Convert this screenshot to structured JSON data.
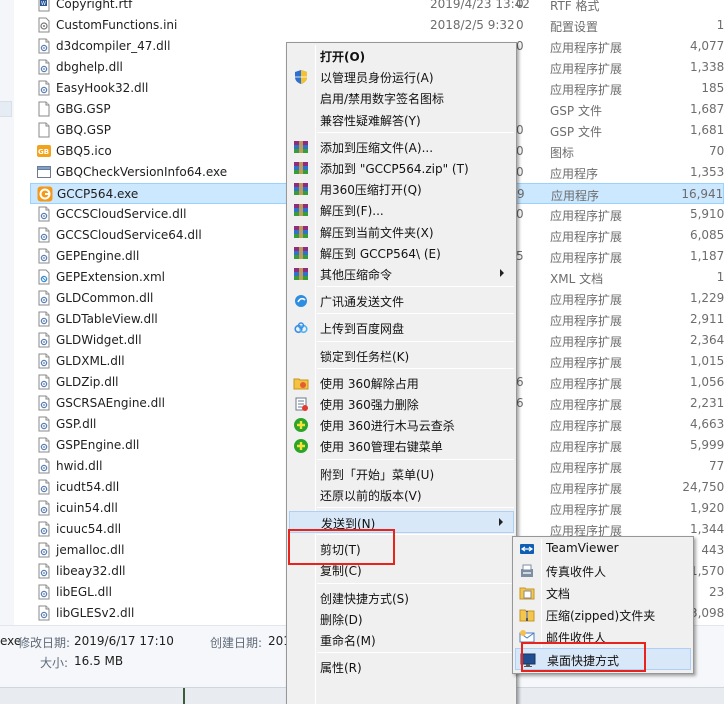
{
  "files": [
    {
      "name": "Copyright.rtf",
      "date": "2019/4/23 13:42",
      "type": "RTF 格式",
      "size": "",
      "icon": "rtf-file-icon"
    },
    {
      "name": "CustomFunctions.ini",
      "date": "2018/2/5 9:32",
      "type": "配置设置",
      "size": "1 K",
      "icon": "ini-file-icon"
    },
    {
      "name": "d3dcompiler_47.dll",
      "date": "",
      "type": "应用程序扩展",
      "size": "4,077 K",
      "icon": "dll-file-icon"
    },
    {
      "name": "dbghelp.dll",
      "date": "",
      "type": "应用程序扩展",
      "size": "1,338 K",
      "icon": "dll-file-icon"
    },
    {
      "name": "EasyHook32.dll",
      "date": "",
      "type": "应用程序扩展",
      "size": "185 K",
      "icon": "dll-file-icon"
    },
    {
      "name": "GBG.GSP",
      "date": "",
      "type": "GSP 文件",
      "size": "1,687 K",
      "icon": "blank-file-icon"
    },
    {
      "name": "GBQ.GSP",
      "date": "",
      "type": "GSP 文件",
      "size": "1,681 K",
      "icon": "blank-file-icon"
    },
    {
      "name": "GBQ5.ico",
      "date": "",
      "type": "图标",
      "size": "70 K",
      "icon": "ico-file-icon"
    },
    {
      "name": "GBQCheckVersionInfo64.exe",
      "date": "",
      "type": "应用程序",
      "size": "1,353 K",
      "icon": "exe-file-icon"
    },
    {
      "name": "GCCP564.exe",
      "date": "",
      "type": "应用程序",
      "size": "16,941 K",
      "icon": "gccp-app-icon",
      "selected": true
    },
    {
      "name": "GCCSCloudService.dll",
      "date": "",
      "type": "应用程序扩展",
      "size": "5,910 K",
      "icon": "dll-file-icon"
    },
    {
      "name": "GCCSCloudService64.dll",
      "date": "",
      "type": "应用程序扩展",
      "size": "6,085 K",
      "icon": "dll-file-icon"
    },
    {
      "name": "GEPEngine.dll",
      "date": "",
      "type": "应用程序扩展",
      "size": "1,187 K",
      "icon": "dll-file-icon"
    },
    {
      "name": "GEPExtension.xml",
      "date": "",
      "type": "XML 文档",
      "size": "1 K",
      "icon": "xml-file-icon"
    },
    {
      "name": "GLDCommon.dll",
      "date": "",
      "type": "应用程序扩展",
      "size": "1,229 K",
      "icon": "dll-file-icon"
    },
    {
      "name": "GLDTableView.dll",
      "date": "",
      "type": "应用程序扩展",
      "size": "2,911 K",
      "icon": "dll-file-icon"
    },
    {
      "name": "GLDWidget.dll",
      "date": "",
      "type": "应用程序扩展",
      "size": "2,364 K",
      "icon": "dll-file-icon"
    },
    {
      "name": "GLDXML.dll",
      "date": "",
      "type": "应用程序扩展",
      "size": "1,015 K",
      "icon": "dll-file-icon"
    },
    {
      "name": "GLDZip.dll",
      "date": "",
      "type": "应用程序扩展",
      "size": "1,056 K",
      "icon": "dll-file-icon"
    },
    {
      "name": "GSCRSAEngine.dll",
      "date": "",
      "type": "应用程序扩展",
      "size": "2,231 K",
      "icon": "dll-file-icon"
    },
    {
      "name": "GSP.dll",
      "date": "",
      "type": "应用程序扩展",
      "size": "4,663 K",
      "icon": "dll-file-icon"
    },
    {
      "name": "GSPEngine.dll",
      "date": "",
      "type": "应用程序扩展",
      "size": "5,999 K",
      "icon": "dll-file-icon"
    },
    {
      "name": "hwid.dll",
      "date": "",
      "type": "应用程序扩展",
      "size": "77 K",
      "icon": "dll-file-icon"
    },
    {
      "name": "icudt54.dll",
      "date": "",
      "type": "应用程序扩展",
      "size": "24,750 K",
      "icon": "dll-file-icon"
    },
    {
      "name": "icuin54.dll",
      "date": "",
      "type": "应用程序扩展",
      "size": "1,920 K",
      "icon": "dll-file-icon"
    },
    {
      "name": "icuuc54.dll",
      "date": "",
      "type": "应用程序扩展",
      "size": "1,344 K",
      "icon": "dll-file-icon"
    },
    {
      "name": "jemalloc.dll",
      "date": "",
      "type": "",
      "size": "443 K",
      "icon": "dll-file-icon"
    },
    {
      "name": "libeay32.dll",
      "date": "",
      "type": "",
      "size": "1,570 K",
      "icon": "dll-file-icon"
    },
    {
      "name": "libEGL.dll",
      "date": "",
      "type": "",
      "size": "23 K",
      "icon": "dll-file-icon"
    },
    {
      "name": "libGLESv2.dll",
      "date": "",
      "type": "",
      "size": "3,098 K",
      "icon": "dll-file-icon"
    }
  ],
  "stray_digits": [
    "0",
    "0",
    "0",
    "",
    "",
    "",
    "0",
    "0",
    "0",
    "9",
    "0",
    "",
    "5",
    "",
    "",
    "",
    "",
    "",
    "6",
    "6"
  ],
  "details": {
    "name_fragment": "exe",
    "modified_label": "修改日期:",
    "modified_value": "2019/6/17 17:10",
    "created_label": "创建日期:",
    "created_value": "201",
    "size_label": "大小:",
    "size_value": "16.5 MB"
  },
  "context_menu": {
    "items": [
      {
        "label": "打开(O)",
        "bold": true,
        "icon": ""
      },
      {
        "label": "以管理员身份运行(A)",
        "icon": "shield-icon"
      },
      {
        "label": "启用/禁用数字签名图标",
        "icon": ""
      },
      {
        "label": "兼容性疑难解答(Y)",
        "icon": ""
      },
      {
        "sep": true
      },
      {
        "label": "添加到压缩文件(A)...",
        "icon": "winrar-icon"
      },
      {
        "label": "添加到 \"GCCP564.zip\" (T)",
        "icon": "winrar-icon"
      },
      {
        "label": "用360压缩打开(Q)",
        "icon": "winrar-icon"
      },
      {
        "label": "解压到(F)...",
        "icon": "winrar-icon"
      },
      {
        "label": "解压到当前文件夹(X)",
        "icon": "winrar-icon"
      },
      {
        "label": "解压到 GCCP564\\ (E)",
        "icon": "winrar-icon"
      },
      {
        "label": "其他压缩命令",
        "icon": "winrar-icon",
        "submenu": true
      },
      {
        "sep": true
      },
      {
        "label": "广讯通发送文件",
        "icon": "gxt-icon"
      },
      {
        "sep": true
      },
      {
        "label": "上传到百度网盘",
        "icon": "baidu-cloud-icon"
      },
      {
        "sep": true
      },
      {
        "label": "锁定到任务栏(K)",
        "icon": ""
      },
      {
        "sep": true
      },
      {
        "label": "使用 360解除占用",
        "icon": "folder-360-icon"
      },
      {
        "label": "使用 360强力删除",
        "icon": "delete-360-icon"
      },
      {
        "label": "使用 360进行木马云查杀",
        "icon": "shield-360-icon"
      },
      {
        "label": "使用 360管理右键菜单",
        "icon": "shield-360-icon"
      },
      {
        "sep": true
      },
      {
        "label": "附到「开始」菜单(U)",
        "icon": ""
      },
      {
        "label": "还原以前的版本(V)",
        "icon": ""
      },
      {
        "sep": true
      },
      {
        "label": "发送到(N)",
        "icon": "",
        "submenu": true,
        "highlighted": true
      },
      {
        "sep": true
      },
      {
        "label": "剪切(T)",
        "icon": ""
      },
      {
        "label": "复制(C)",
        "icon": ""
      },
      {
        "sep": true
      },
      {
        "label": "创建快捷方式(S)",
        "icon": ""
      },
      {
        "label": "删除(D)",
        "icon": ""
      },
      {
        "label": "重命名(M)",
        "icon": ""
      },
      {
        "sep": true
      },
      {
        "label": "属性(R)",
        "icon": ""
      }
    ]
  },
  "send_to_menu": {
    "items": [
      {
        "label": "TeamViewer",
        "icon": "teamviewer-icon"
      },
      {
        "label": "传真收件人",
        "icon": "fax-icon"
      },
      {
        "label": "文档",
        "icon": "documents-icon"
      },
      {
        "label": "压缩(zipped)文件夹",
        "icon": "zip-folder-icon"
      },
      {
        "label": "邮件收件人",
        "icon": "mail-icon"
      },
      {
        "label": "桌面快捷方式",
        "icon": "desktop-icon",
        "highlighted": true
      }
    ]
  },
  "colors": {
    "selection": "#cce8ff",
    "menu_bg": "#f0f0f0",
    "menu_highlight": "#d9e8f8",
    "red_box": "#e8231c"
  }
}
